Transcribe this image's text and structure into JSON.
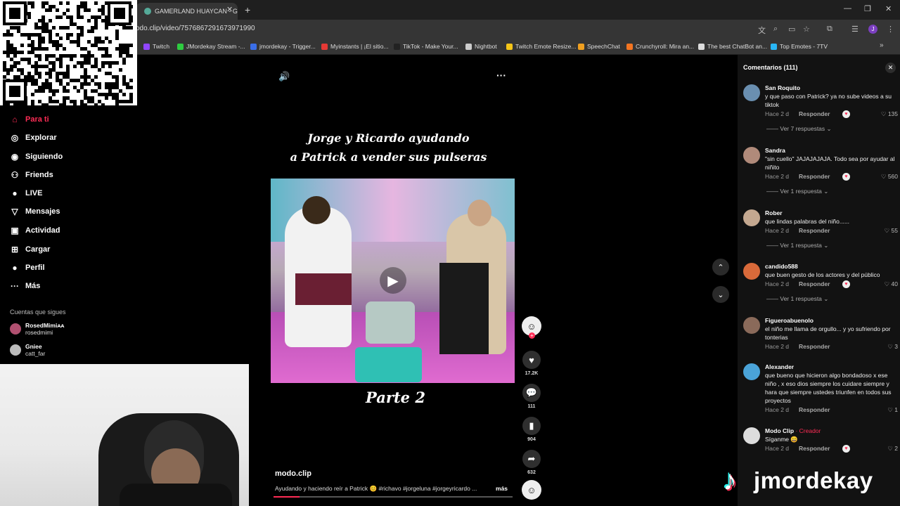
{
  "browser": {
    "tab_title": "GAMERLAND HUAYCAN - Goo",
    "url": "odo.clip/video/7576867291673971990",
    "bookmarks": [
      {
        "label": "Twitch",
        "color": "#9146ff"
      },
      {
        "label": "JMordekay Stream -...",
        "color": "#2ecc40"
      },
      {
        "label": "jmordekay - Trigger...",
        "color": "#3a6ee8"
      },
      {
        "label": "Myinstants | ¡El sitio...",
        "color": "#e53935"
      },
      {
        "label": "TikTok - Make Your...",
        "color": "#222222"
      },
      {
        "label": "Nightbot",
        "color": "#cccccc"
      },
      {
        "label": "Twitch Emote Resize...",
        "color": "#f5c518"
      },
      {
        "label": "SpeechChat",
        "color": "#f0a020"
      },
      {
        "label": "Crunchyroll: Mira an...",
        "color": "#f47521"
      },
      {
        "label": "The best ChatBot an...",
        "color": "#dddddd"
      },
      {
        "label": "Top Emotes - 7TV",
        "color": "#29b6f6"
      }
    ]
  },
  "sidebar": {
    "items": [
      {
        "label": "Para ti",
        "icon": "home-icon"
      },
      {
        "label": "Explorar",
        "icon": "compass-icon"
      },
      {
        "label": "Siguiendo",
        "icon": "following-icon"
      },
      {
        "label": "Friends",
        "icon": "friends-icon"
      },
      {
        "label": "LIVE",
        "icon": "live-icon"
      },
      {
        "label": "Mensajes",
        "icon": "messages-icon"
      },
      {
        "label": "Actividad",
        "icon": "activity-icon"
      },
      {
        "label": "Cargar",
        "icon": "upload-icon"
      },
      {
        "label": "Perfil",
        "icon": "profile-icon"
      },
      {
        "label": "Más",
        "icon": "more-icon"
      }
    ],
    "following_title": "Cuentas que sigues",
    "following": [
      {
        "name": "RosedMimiᴀᴀ",
        "handle": "rosedmimi"
      },
      {
        "name": "Gniee",
        "handle": "catt_far"
      }
    ]
  },
  "video": {
    "caption_line1": "Jorge y Ricardo ayudando",
    "caption_line2": "a Patrick a vender sus pulseras",
    "part_label": "Parte 2",
    "author": "modo.clip",
    "description": "Ayudando y haciendo reír a Patrick 😊 #richavo #jorgeluna #jorgeyricardo ...",
    "more_label": "más",
    "progress": 0.11,
    "likes": "17.2K",
    "comments": "111",
    "saves": "904",
    "shares": "632"
  },
  "comments": {
    "title": "Comentarios (111)",
    "items": [
      {
        "user": "San Roquito",
        "creator": "",
        "text": "y que paso con Patrick? ya no sube videos a su tiktok",
        "time": "Hace 2 d",
        "reply": "Responder",
        "liked": true,
        "likes": "135",
        "replies": "Ver 7 respuestas ⌄",
        "avatar": "#6a8fb0"
      },
      {
        "user": "Sandra",
        "creator": "",
        "text": "\"sin cuello\" JAJAJAJAJA. Todo sea por ayudar al niñito",
        "time": "Hace 2 d",
        "reply": "Responder",
        "liked": true,
        "likes": "560",
        "replies": "Ver 1 respuesta ⌄",
        "avatar": "#b08a7a"
      },
      {
        "user": "Rober",
        "creator": "",
        "text": "que lindas palabras del niño......",
        "time": "Hace 2 d",
        "reply": "Responder",
        "liked": false,
        "likes": "55",
        "replies": "Ver 1 respuesta ⌄",
        "avatar": "#c4a890"
      },
      {
        "user": "candido588",
        "creator": "",
        "text": "que buen gesto de los actores y del público",
        "time": "Hace 2 d",
        "reply": "Responder",
        "liked": true,
        "likes": "40",
        "replies": "Ver 1 respuesta ⌄",
        "avatar": "#d96a3a"
      },
      {
        "user": "Figueroabuenolo",
        "creator": "",
        "text": "el niño me llama de orgullo... y yo sufriendo por tonterias",
        "time": "Hace 2 d",
        "reply": "Responder",
        "liked": false,
        "likes": "3",
        "replies": "",
        "avatar": "#8a6a5a"
      },
      {
        "user": "Alexander",
        "creator": "",
        "text": "que bueno que hicieron algo bondadoso x ese niño , x eso dios siempre los cuidare siempre y hara que siempre ustedes triunfen en todos sus proyectos",
        "time": "Hace 2 d",
        "reply": "Responder",
        "liked": false,
        "likes": "1",
        "replies": "",
        "avatar": "#4aa3d8"
      },
      {
        "user": "Modo Clip",
        "creator": "· Creador",
        "text": "Síganme 😄",
        "time": "Hace 2 d",
        "reply": "Responder",
        "liked": true,
        "likes": "2",
        "replies": "",
        "avatar": "#dddddd"
      }
    ]
  },
  "overlay": {
    "streamer": "jmordekay"
  },
  "colors": {
    "accent": "#fe2c55",
    "panel": "#121212"
  }
}
